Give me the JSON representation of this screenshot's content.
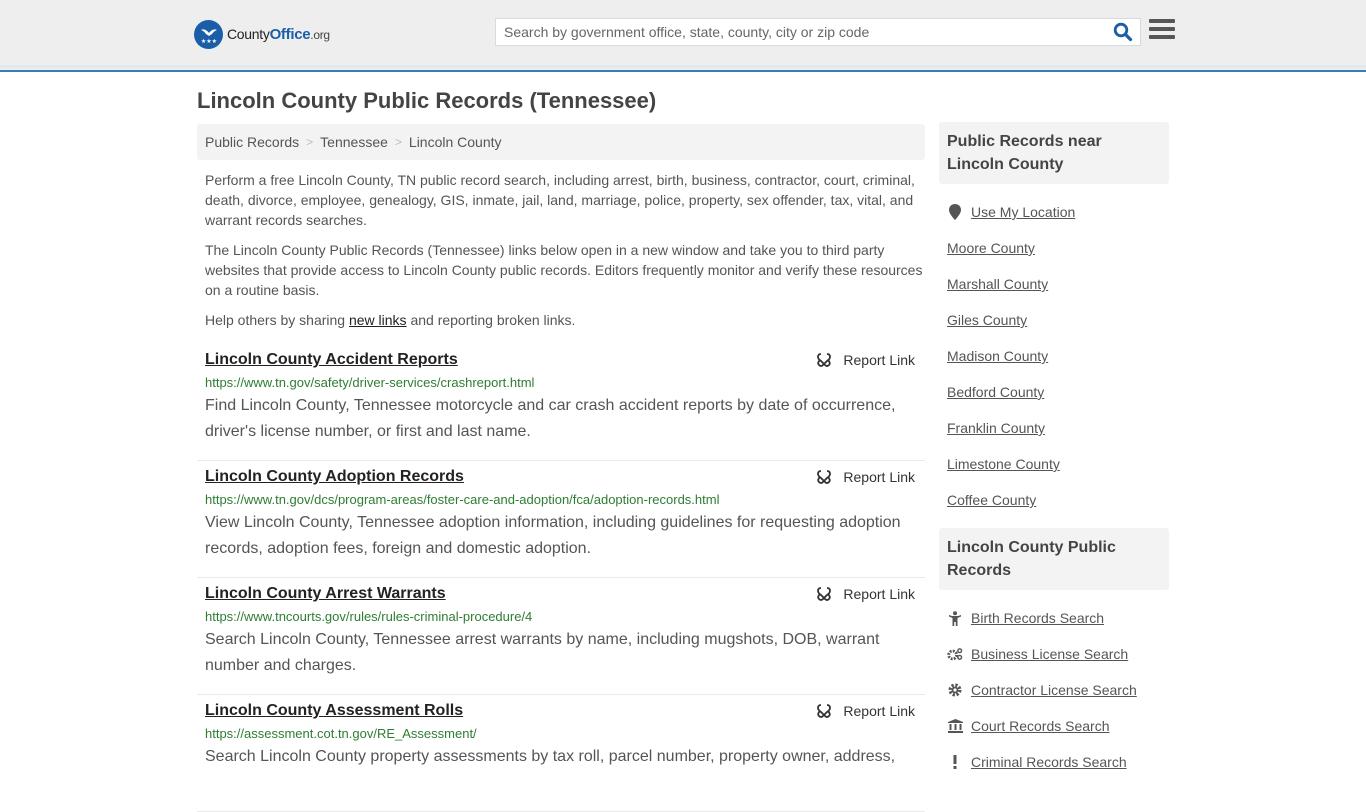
{
  "header": {
    "logo": {
      "brand_prefix": "County",
      "brand_main": "Office",
      "brand_suffix": ".org"
    },
    "search": {
      "placeholder": "Search by government office, state, county, city or zip code",
      "value": ""
    },
    "icons": {
      "search": "search-icon",
      "menu": "hamburger-menu-icon"
    }
  },
  "page": {
    "title": "Lincoln County Public Records (Tennessee)",
    "breadcrumb": [
      {
        "label": "Public Records"
      },
      {
        "label": "Tennessee"
      },
      {
        "label": "Lincoln County"
      }
    ],
    "breadcrumb_separator": ">",
    "intro": {
      "p1": "Perform a free Lincoln County, TN public record search, including arrest, birth, business, contractor, court, criminal, death, divorce, employee, genealogy, GIS, inmate, jail, land, marriage, police, property, sex offender, tax, vital, and warrant records searches.",
      "p2": "The Lincoln County Public Records (Tennessee) links below open in a new window and take you to third party websites that provide access to Lincoln County public records. Editors frequently monitor and verify these resources on a routine basis.",
      "p3_before": "Help others by sharing ",
      "p3_link": "new links",
      "p3_after": " and reporting broken links."
    }
  },
  "records": [
    {
      "title": "Lincoln County Accident Reports",
      "url": "https://www.tn.gov/safety/driver-services/crashreport.html",
      "description": "Find Lincoln County, Tennessee motorcycle and car crash accident reports by date of occurrence, driver's license number, or first and last name.",
      "report_label": "Report Link"
    },
    {
      "title": "Lincoln County Adoption Records",
      "url": "https://www.tn.gov/dcs/program-areas/foster-care-and-adoption/fca/adoption-records.html",
      "description": "View Lincoln County, Tennessee adoption information, including guidelines for requesting adoption records, adoption fees, foreign and domestic adoption.",
      "report_label": "Report Link"
    },
    {
      "title": "Lincoln County Arrest Warrants",
      "url": "https://www.tncourts.gov/rules/rules-criminal-procedure/4",
      "description": "Search Lincoln County, Tennessee arrest warrants by name, including mugshots, DOB, warrant number and charges.",
      "report_label": "Report Link"
    },
    {
      "title": "Lincoln County Assessment Rolls",
      "url": "https://assessment.cot.tn.gov/RE_Assessment/",
      "description": "Search Lincoln County property assessments by tax roll, parcel number, property owner, address,",
      "report_label": "Report Link"
    }
  ],
  "sidebar": {
    "nearby": {
      "heading": "Public Records near Lincoln County",
      "use_location": "Use My Location",
      "counties": [
        "Moore County",
        "Marshall County",
        "Giles County",
        "Madison County",
        "Bedford County",
        "Franklin County",
        "Limestone County",
        "Coffee County"
      ]
    },
    "county_records": {
      "heading": "Lincoln County Public Records",
      "items": [
        {
          "label": "Birth Records Search",
          "icon": "child-icon"
        },
        {
          "label": "Business License Search",
          "icon": "gears-icon"
        },
        {
          "label": "Contractor License Search",
          "icon": "gear-icon"
        },
        {
          "label": "Court Records Search",
          "icon": "courthouse-icon"
        },
        {
          "label": "Criminal Records Search",
          "icon": "exclamation-icon"
        }
      ]
    }
  },
  "colors": {
    "brand_blue": "#1b5ea8",
    "header_border": "#3a7db0",
    "url_green": "#2e7d32",
    "header_bg": "#eeeeee"
  }
}
